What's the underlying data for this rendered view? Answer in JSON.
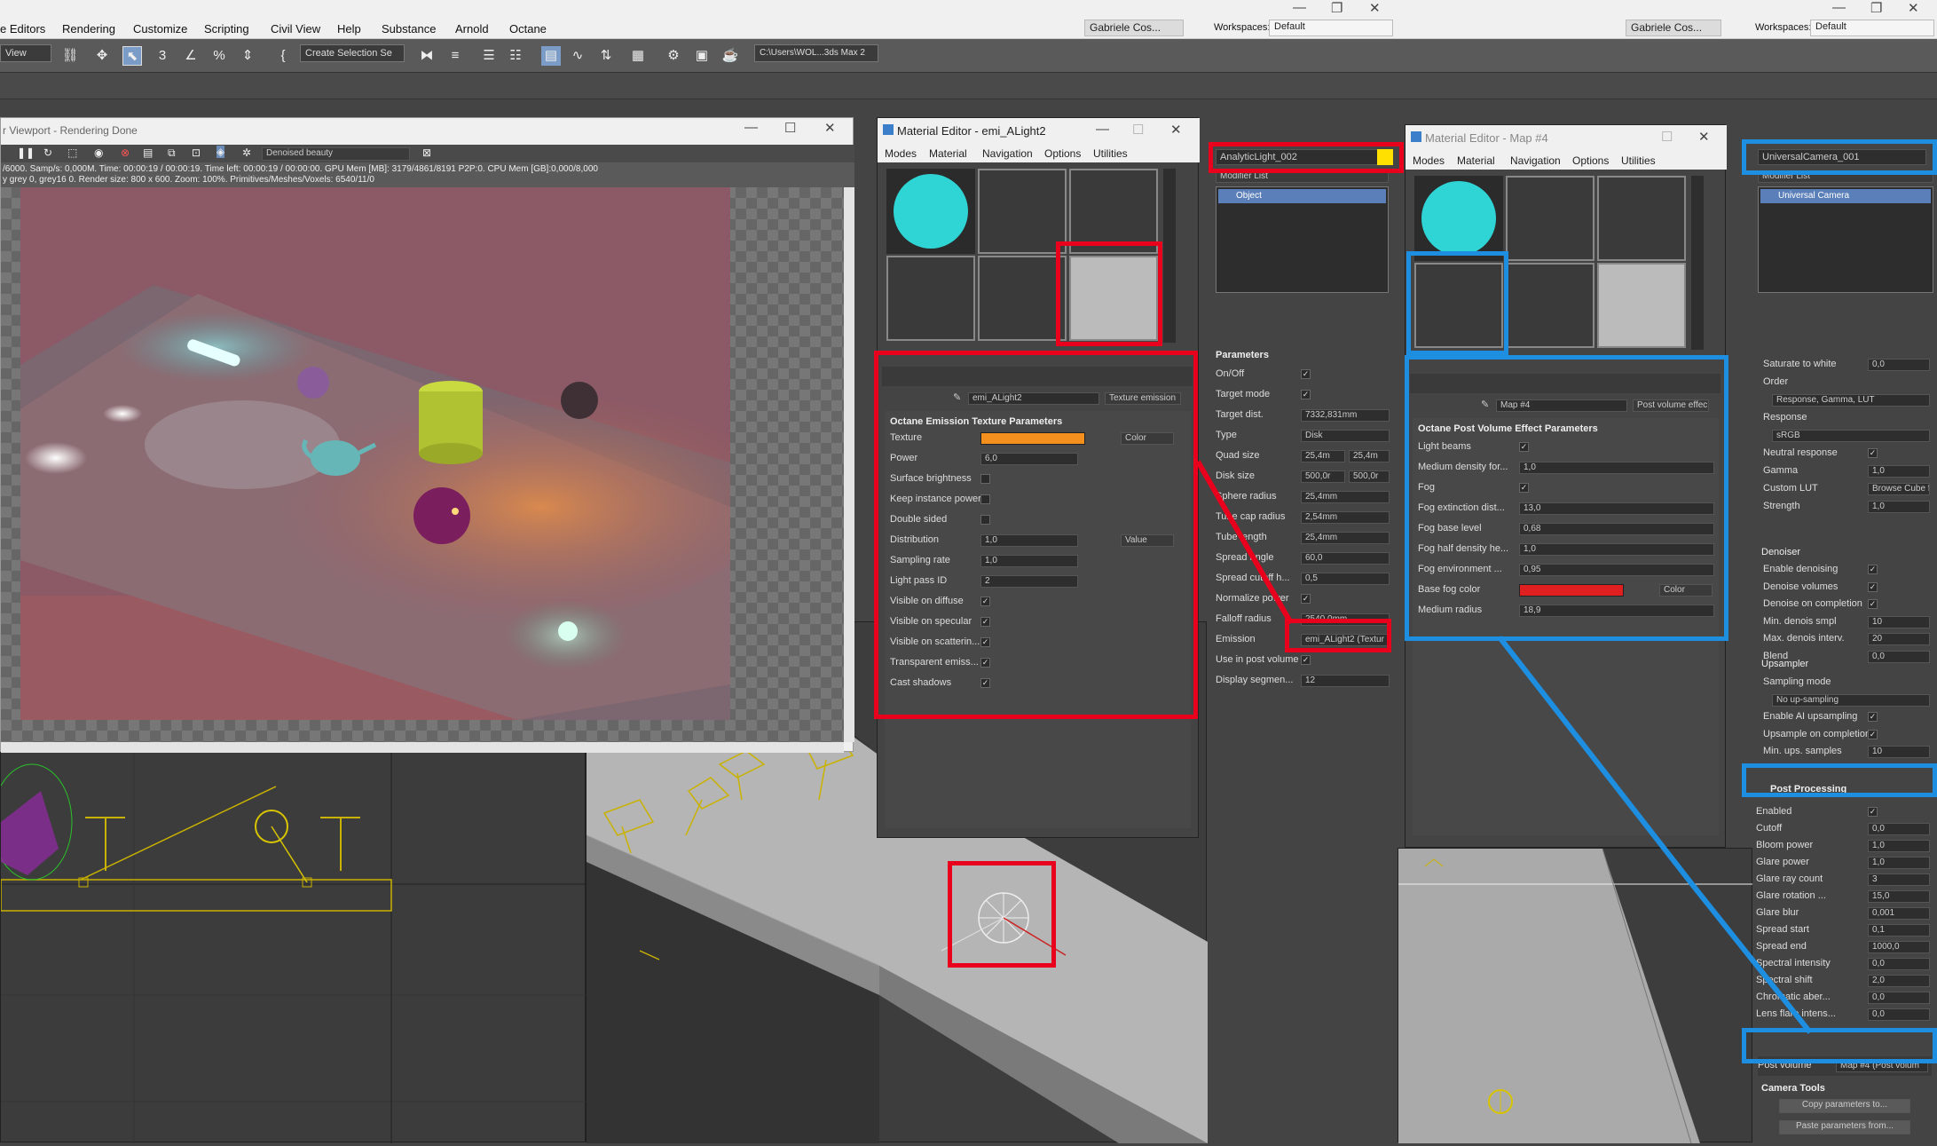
{
  "menubar": {
    "items": [
      "e Editors",
      "Rendering",
      "Customize",
      "Scripting",
      "Civil View",
      "Help",
      "Substance",
      "Arnold",
      "Octane"
    ],
    "user1": "Gabriele Cos...",
    "workspaces_label": "Workspaces:",
    "workspace1": "Default",
    "user2": "Gabriele Cos...",
    "workspace2": "Default"
  },
  "toolbar": {
    "view_select": "View",
    "selection_set": "Create Selection Se",
    "path": "C:\\Users\\WOL...3ds Max 2"
  },
  "render_window": {
    "title": "r Viewport - Rendering Done",
    "pass": "Denoised beauty",
    "stats1": "/6000.  Samp/s: 0,000M.  Time: 00:00:19 / 00:00:19.  Time left: 00:00:19 / 00:00:00.  GPU Mem [MB]: 3179/4861/8191 P2P:0.  CPU Mem [GB]:0,000/8,000",
    "stats2": "y grey 0, grey16 0.  Render size: 800 x 600.  Zoom: 100%.  Primitives/Meshes/Voxels: 6540/11/0"
  },
  "mat_editor1": {
    "title": "Material Editor - emi_ALight2",
    "menu": [
      "Modes",
      "Material",
      "Navigation",
      "Options",
      "Utilities"
    ],
    "name": "emi_ALight2",
    "type": "Texture emission",
    "section": "Octane Emission Texture Parameters",
    "rows": [
      {
        "label": "Texture",
        "value": "",
        "kind": "swatch",
        "extra": "Color"
      },
      {
        "label": "Power",
        "value": "6,0",
        "kind": "field"
      },
      {
        "label": "Surface brightness",
        "kind": "check",
        "checked": false
      },
      {
        "label": "Keep instance power",
        "kind": "check",
        "checked": false
      },
      {
        "label": "Double sided",
        "kind": "check",
        "checked": false
      },
      {
        "label": "Distribution",
        "value": "1,0",
        "kind": "field",
        "extra": "Value"
      },
      {
        "label": "Sampling rate",
        "value": "1,0",
        "kind": "field"
      },
      {
        "label": "Light pass ID",
        "value": "2",
        "kind": "field"
      },
      {
        "label": "Visible on diffuse",
        "kind": "check",
        "checked": true
      },
      {
        "label": "Visible on specular",
        "kind": "check",
        "checked": true
      },
      {
        "label": "Visible on scatterin...",
        "kind": "check",
        "checked": true
      },
      {
        "label": "Transparent emiss...",
        "kind": "check",
        "checked": true
      },
      {
        "label": "Cast shadows",
        "kind": "check",
        "checked": true
      }
    ],
    "swatch_color": "#f5901f"
  },
  "cmd_panel1": {
    "object": "AnalyticLight_002",
    "modifier_list": "Modifier List",
    "stack_item": "Object",
    "section": "Parameters",
    "rows": [
      {
        "label": "On/Off",
        "kind": "check"
      },
      {
        "label": "Target mode",
        "kind": "check"
      },
      {
        "label": "Target dist.",
        "value": "7332,831mm"
      },
      {
        "label": "Type",
        "value": "Disk"
      },
      {
        "label": "Quad size",
        "value": "25,4m",
        "value2": "25,4m"
      },
      {
        "label": "Disk size",
        "value": "500,0r",
        "value2": "500,0r"
      },
      {
        "label": "Sphere radius",
        "value": "25,4mm"
      },
      {
        "label": "Tube cap radius",
        "value": "2,54mm"
      },
      {
        "label": "Tube length",
        "value": "25,4mm"
      },
      {
        "label": "Spread angle",
        "value": "60,0"
      },
      {
        "label": "Spread cutoff h...",
        "value": "0,5"
      },
      {
        "label": "Normalize power",
        "kind": "check"
      },
      {
        "label": "Falloff radius",
        "value": "2540,0mm"
      },
      {
        "label": "Emission",
        "value": "emi_ALight2 (Textur"
      },
      {
        "label": "Use in post volume",
        "kind": "check"
      },
      {
        "label": "Display segmen...",
        "value": "12"
      }
    ]
  },
  "mat_editor2": {
    "title": "Material Editor - Map #4",
    "menu": [
      "Modes",
      "Material",
      "Navigation",
      "Options",
      "Utilities"
    ],
    "name": "Map #4",
    "type": "Post volume effec",
    "section": "Octane Post Volume Effect Parameters",
    "rows": [
      {
        "label": "Light beams",
        "kind": "check"
      },
      {
        "label": "Medium density for...",
        "value": "1,0"
      },
      {
        "label": "Fog",
        "kind": "check"
      },
      {
        "label": "Fog extinction dist...",
        "value": "13,0"
      },
      {
        "label": "Fog base level",
        "value": "0,68"
      },
      {
        "label": "Fog half density he...",
        "value": "1,0"
      },
      {
        "label": "Fog environment ...",
        "value": "0,95"
      },
      {
        "label": "Base fog color",
        "value": "",
        "kind": "swatch",
        "extra": "Color"
      },
      {
        "label": "Medium radius",
        "value": "18,9"
      }
    ],
    "swatch_color": "#e02020"
  },
  "cmd_panel2": {
    "object": "UniversalCamera_001",
    "modifier_list": "Modifier List",
    "stack_item": "Universal Camera",
    "rows": [
      {
        "label": "Saturate to white",
        "value": "0,0"
      },
      {
        "label": "Order",
        "kind": "label"
      },
      {
        "label": "",
        "value": "Response, Gamma, LUT",
        "kind": "dropdown"
      },
      {
        "label": "Response",
        "kind": "label"
      },
      {
        "label": "",
        "value": "sRGB",
        "kind": "dropdown"
      },
      {
        "label": "Neutral response",
        "kind": "check"
      },
      {
        "label": "Gamma",
        "value": "1,0"
      },
      {
        "label": "Custom LUT",
        "value": "Browse Cube file..."
      },
      {
        "label": "Strength",
        "value": "1,0"
      }
    ],
    "denoiser": {
      "header": "Denoiser",
      "rows": [
        {
          "label": "Enable denoising",
          "kind": "check"
        },
        {
          "label": "Denoise volumes",
          "kind": "check"
        },
        {
          "label": "Denoise on completion",
          "kind": "check"
        },
        {
          "label": "Min. denois smpl",
          "value": "10"
        },
        {
          "label": "Max. denois interv.",
          "value": "20"
        },
        {
          "label": "Blend",
          "value": "0,0"
        }
      ]
    },
    "upsampler": {
      "header": "Upsampler",
      "rows": [
        {
          "label": "Sampling mode",
          "kind": "label"
        },
        {
          "label": "",
          "value": "No up-sampling",
          "kind": "dropdown"
        },
        {
          "label": "Enable AI upsampling",
          "kind": "check"
        },
        {
          "label": "Upsample on completion",
          "kind": "check"
        },
        {
          "label": "Min. ups. samples",
          "value": "10"
        }
      ]
    },
    "post": {
      "header": "Post Processing",
      "rows": [
        {
          "label": "Enabled",
          "kind": "check"
        },
        {
          "label": "Cutoff",
          "value": "0,0"
        },
        {
          "label": "Bloom power",
          "value": "1,0"
        },
        {
          "label": "Glare power",
          "value": "1,0"
        },
        {
          "label": "Glare ray count",
          "value": "3"
        },
        {
          "label": "Glare rotation ...",
          "value": "15,0"
        },
        {
          "label": "Glare blur",
          "value": "0,001"
        },
        {
          "label": "Spread start",
          "value": "0,1"
        },
        {
          "label": "Spread end",
          "value": "1000,0"
        },
        {
          "label": "Spectral intensity",
          "value": "0,0"
        },
        {
          "label": "Spectral shift",
          "value": "2,0"
        },
        {
          "label": "Chromatic aber...",
          "value": "0,0"
        },
        {
          "label": "Lens flare intens...",
          "value": "0,0"
        }
      ]
    },
    "post_volume_label": "Post volume",
    "post_volume_value": "Map #4 (Post volum",
    "camera_tools": "Camera Tools",
    "copy_btn": "Copy parameters to...",
    "paste_btn": "Paste parameters from..."
  },
  "colors": {
    "highlight_red": "#e8001d",
    "highlight_blue": "#1e8fe0",
    "object_color": "#ffe000"
  }
}
